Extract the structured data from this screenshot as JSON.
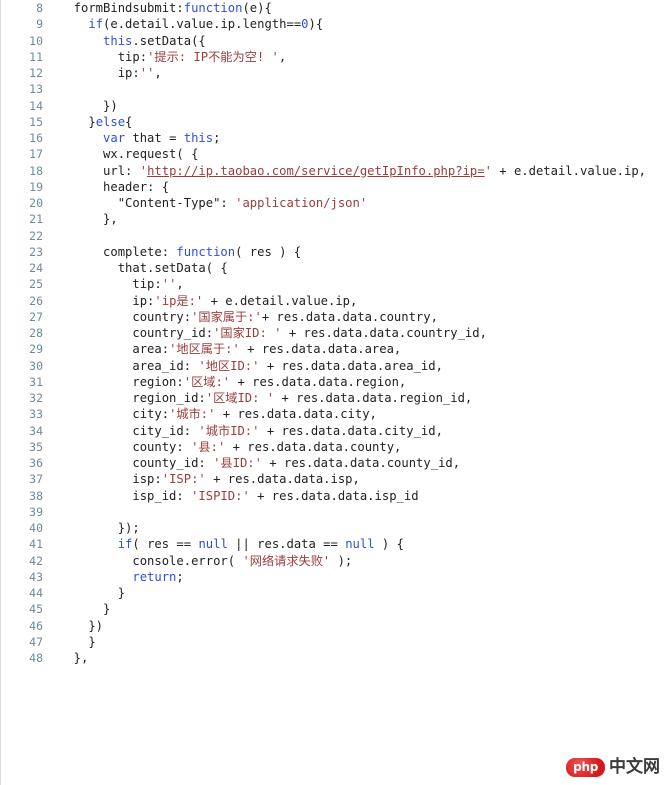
{
  "viewer": {
    "language": "javascript",
    "first_line_number": 8,
    "last_line_number": 48,
    "background_color": "#ffffff",
    "gutter_color": "#6a8ba0",
    "keyword_color": "#2f4fd8",
    "string_color": "#9b3d3d",
    "text_color": "#222222"
  },
  "watermark": {
    "badge_label": "php",
    "text_label": "中文网",
    "badge_color": "#d81e20",
    "text_color": "#3b3b3b"
  },
  "lines": [
    {
      "n": "8",
      "tokens": [
        {
          "t": "plain",
          "v": "  formBindsubmit:"
        },
        {
          "t": "kw",
          "v": "function"
        },
        {
          "t": "plain",
          "v": "(e){"
        }
      ]
    },
    {
      "n": "9",
      "tokens": [
        {
          "t": "plain",
          "v": "    "
        },
        {
          "t": "kw",
          "v": "if"
        },
        {
          "t": "plain",
          "v": "(e.detail.value.ip.length=="
        },
        {
          "t": "num",
          "v": "0"
        },
        {
          "t": "plain",
          "v": "){"
        }
      ]
    },
    {
      "n": "10",
      "tokens": [
        {
          "t": "plain",
          "v": "      "
        },
        {
          "t": "kw",
          "v": "this"
        },
        {
          "t": "plain",
          "v": ".setData({"
        }
      ]
    },
    {
      "n": "11",
      "tokens": [
        {
          "t": "plain",
          "v": "        tip:"
        },
        {
          "t": "str",
          "v": "'提示: IP不能为空! '"
        },
        {
          "t": "plain",
          "v": ","
        }
      ]
    },
    {
      "n": "12",
      "tokens": [
        {
          "t": "plain",
          "v": "        ip:"
        },
        {
          "t": "str",
          "v": "''"
        },
        {
          "t": "plain",
          "v": ","
        }
      ]
    },
    {
      "n": "13",
      "tokens": []
    },
    {
      "n": "14",
      "tokens": [
        {
          "t": "plain",
          "v": "      })"
        }
      ]
    },
    {
      "n": "15",
      "tokens": [
        {
          "t": "plain",
          "v": "    }"
        },
        {
          "t": "kw",
          "v": "else"
        },
        {
          "t": "plain",
          "v": "{"
        }
      ]
    },
    {
      "n": "16",
      "tokens": [
        {
          "t": "plain",
          "v": "      "
        },
        {
          "t": "kw",
          "v": "var"
        },
        {
          "t": "plain",
          "v": " that = "
        },
        {
          "t": "kw",
          "v": "this"
        },
        {
          "t": "plain",
          "v": ";"
        }
      ]
    },
    {
      "n": "17",
      "tokens": [
        {
          "t": "plain",
          "v": "      wx.request( {"
        }
      ]
    },
    {
      "n": "18",
      "tokens": [
        {
          "t": "plain",
          "v": "      url: "
        },
        {
          "t": "str",
          "v": "'"
        },
        {
          "t": "url",
          "v": "http://ip.taobao.com/service/getIpInfo.php?ip="
        },
        {
          "t": "str",
          "v": "'"
        },
        {
          "t": "plain",
          "v": " + e.detail.value.ip,"
        }
      ]
    },
    {
      "n": "19",
      "tokens": [
        {
          "t": "plain",
          "v": "      header: {"
        }
      ]
    },
    {
      "n": "20",
      "tokens": [
        {
          "t": "plain",
          "v": "        \"Content-Type\": "
        },
        {
          "t": "str",
          "v": "'application/json'"
        }
      ]
    },
    {
      "n": "21",
      "tokens": [
        {
          "t": "plain",
          "v": "      },"
        }
      ]
    },
    {
      "n": "22",
      "tokens": []
    },
    {
      "n": "23",
      "tokens": [
        {
          "t": "plain",
          "v": "      complete: "
        },
        {
          "t": "kw",
          "v": "function"
        },
        {
          "t": "plain",
          "v": "( res ) {"
        }
      ]
    },
    {
      "n": "24",
      "tokens": [
        {
          "t": "plain",
          "v": "        that.setData( {"
        }
      ]
    },
    {
      "n": "25",
      "tokens": [
        {
          "t": "plain",
          "v": "          tip:"
        },
        {
          "t": "str",
          "v": "''"
        },
        {
          "t": "plain",
          "v": ","
        }
      ]
    },
    {
      "n": "26",
      "tokens": [
        {
          "t": "plain",
          "v": "          ip:"
        },
        {
          "t": "str",
          "v": "'ip是:'"
        },
        {
          "t": "plain",
          "v": " + e.detail.value.ip,"
        }
      ]
    },
    {
      "n": "27",
      "tokens": [
        {
          "t": "plain",
          "v": "          country:"
        },
        {
          "t": "str",
          "v": "'国家属于:'"
        },
        {
          "t": "plain",
          "v": "+ res.data.data.country,"
        }
      ]
    },
    {
      "n": "28",
      "tokens": [
        {
          "t": "plain",
          "v": "          country_id:"
        },
        {
          "t": "str",
          "v": "'国家ID: '"
        },
        {
          "t": "plain",
          "v": " + res.data.data.country_id,"
        }
      ]
    },
    {
      "n": "29",
      "tokens": [
        {
          "t": "plain",
          "v": "          area:"
        },
        {
          "t": "str",
          "v": "'地区属于:'"
        },
        {
          "t": "plain",
          "v": " + res.data.data.area,"
        }
      ]
    },
    {
      "n": "30",
      "tokens": [
        {
          "t": "plain",
          "v": "          area_id: "
        },
        {
          "t": "str",
          "v": "'地区ID:'"
        },
        {
          "t": "plain",
          "v": " + res.data.data.area_id,"
        }
      ]
    },
    {
      "n": "31",
      "tokens": [
        {
          "t": "plain",
          "v": "          region:"
        },
        {
          "t": "str",
          "v": "'区域:'"
        },
        {
          "t": "plain",
          "v": " + res.data.data.region,"
        }
      ]
    },
    {
      "n": "32",
      "tokens": [
        {
          "t": "plain",
          "v": "          region_id:"
        },
        {
          "t": "str",
          "v": "'区域ID: '"
        },
        {
          "t": "plain",
          "v": " + res.data.data.region_id,"
        }
      ]
    },
    {
      "n": "33",
      "tokens": [
        {
          "t": "plain",
          "v": "          city:"
        },
        {
          "t": "str",
          "v": "'城市:'"
        },
        {
          "t": "plain",
          "v": " + res.data.data.city,"
        }
      ]
    },
    {
      "n": "34",
      "tokens": [
        {
          "t": "plain",
          "v": "          city_id: "
        },
        {
          "t": "str",
          "v": "'城市ID:'"
        },
        {
          "t": "plain",
          "v": " + res.data.data.city_id,"
        }
      ]
    },
    {
      "n": "35",
      "tokens": [
        {
          "t": "plain",
          "v": "          county: "
        },
        {
          "t": "str",
          "v": "'县:'"
        },
        {
          "t": "plain",
          "v": " + res.data.data.county,"
        }
      ]
    },
    {
      "n": "36",
      "tokens": [
        {
          "t": "plain",
          "v": "          county_id: "
        },
        {
          "t": "str",
          "v": "'县ID:'"
        },
        {
          "t": "plain",
          "v": " + res.data.data.county_id,"
        }
      ]
    },
    {
      "n": "37",
      "tokens": [
        {
          "t": "plain",
          "v": "          isp:"
        },
        {
          "t": "str",
          "v": "'ISP:'"
        },
        {
          "t": "plain",
          "v": " + res.data.data.isp,"
        }
      ]
    },
    {
      "n": "38",
      "tokens": [
        {
          "t": "plain",
          "v": "          isp_id: "
        },
        {
          "t": "str",
          "v": "'ISPID:'"
        },
        {
          "t": "plain",
          "v": " + res.data.data.isp_id"
        }
      ]
    },
    {
      "n": "39",
      "tokens": []
    },
    {
      "n": "40",
      "tokens": [
        {
          "t": "plain",
          "v": "        });"
        }
      ]
    },
    {
      "n": "41",
      "tokens": [
        {
          "t": "plain",
          "v": "        "
        },
        {
          "t": "kw",
          "v": "if"
        },
        {
          "t": "plain",
          "v": "( res == "
        },
        {
          "t": "kw",
          "v": "null"
        },
        {
          "t": "plain",
          "v": " || res.data == "
        },
        {
          "t": "kw",
          "v": "null"
        },
        {
          "t": "plain",
          "v": " ) {"
        }
      ]
    },
    {
      "n": "42",
      "tokens": [
        {
          "t": "plain",
          "v": "          console.error( "
        },
        {
          "t": "str",
          "v": "'网络请求失败'"
        },
        {
          "t": "plain",
          "v": " );"
        }
      ]
    },
    {
      "n": "43",
      "tokens": [
        {
          "t": "plain",
          "v": "          "
        },
        {
          "t": "kw",
          "v": "return"
        },
        {
          "t": "plain",
          "v": ";"
        }
      ]
    },
    {
      "n": "44",
      "tokens": [
        {
          "t": "plain",
          "v": "        }"
        }
      ]
    },
    {
      "n": "45",
      "tokens": [
        {
          "t": "plain",
          "v": "      }"
        }
      ]
    },
    {
      "n": "46",
      "tokens": [
        {
          "t": "plain",
          "v": "    })"
        }
      ]
    },
    {
      "n": "47",
      "tokens": [
        {
          "t": "plain",
          "v": "    }"
        }
      ]
    },
    {
      "n": "48",
      "tokens": [
        {
          "t": "plain",
          "v": "  },"
        }
      ]
    }
  ]
}
